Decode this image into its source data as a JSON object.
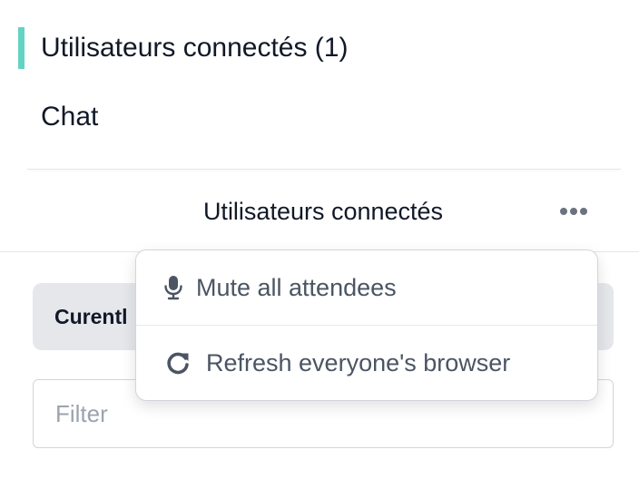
{
  "nav": {
    "items": [
      {
        "label": "Utilisateurs connectés (1)",
        "active": true
      },
      {
        "label": "Chat",
        "active": false
      }
    ],
    "active_color": "#64d3c4"
  },
  "panel": {
    "title": "Utilisateurs connectés",
    "more_icon": "ellipsis-icon"
  },
  "current_tab": {
    "label": "Curentl"
  },
  "filter": {
    "placeholder": "Filter",
    "value": ""
  },
  "menu": {
    "items": [
      {
        "label": "Mute all attendees",
        "icon": "microphone-icon"
      },
      {
        "label": "Refresh everyone's browser",
        "icon": "refresh-icon"
      }
    ]
  }
}
